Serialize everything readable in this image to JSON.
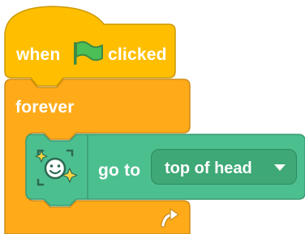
{
  "hat_block": {
    "label_before": "when",
    "label_after": "clicked",
    "flag_icon": "green-flag-icon",
    "color": "#ffbf00"
  },
  "forever_block": {
    "label": "forever",
    "loop_icon": "loop-arrow-icon",
    "color": "#ffab19"
  },
  "go_to_block": {
    "extension_icon": "face-sensing-icon",
    "label": "go to",
    "dropdown_value": "top of head",
    "color": "#4cbf8f"
  }
}
